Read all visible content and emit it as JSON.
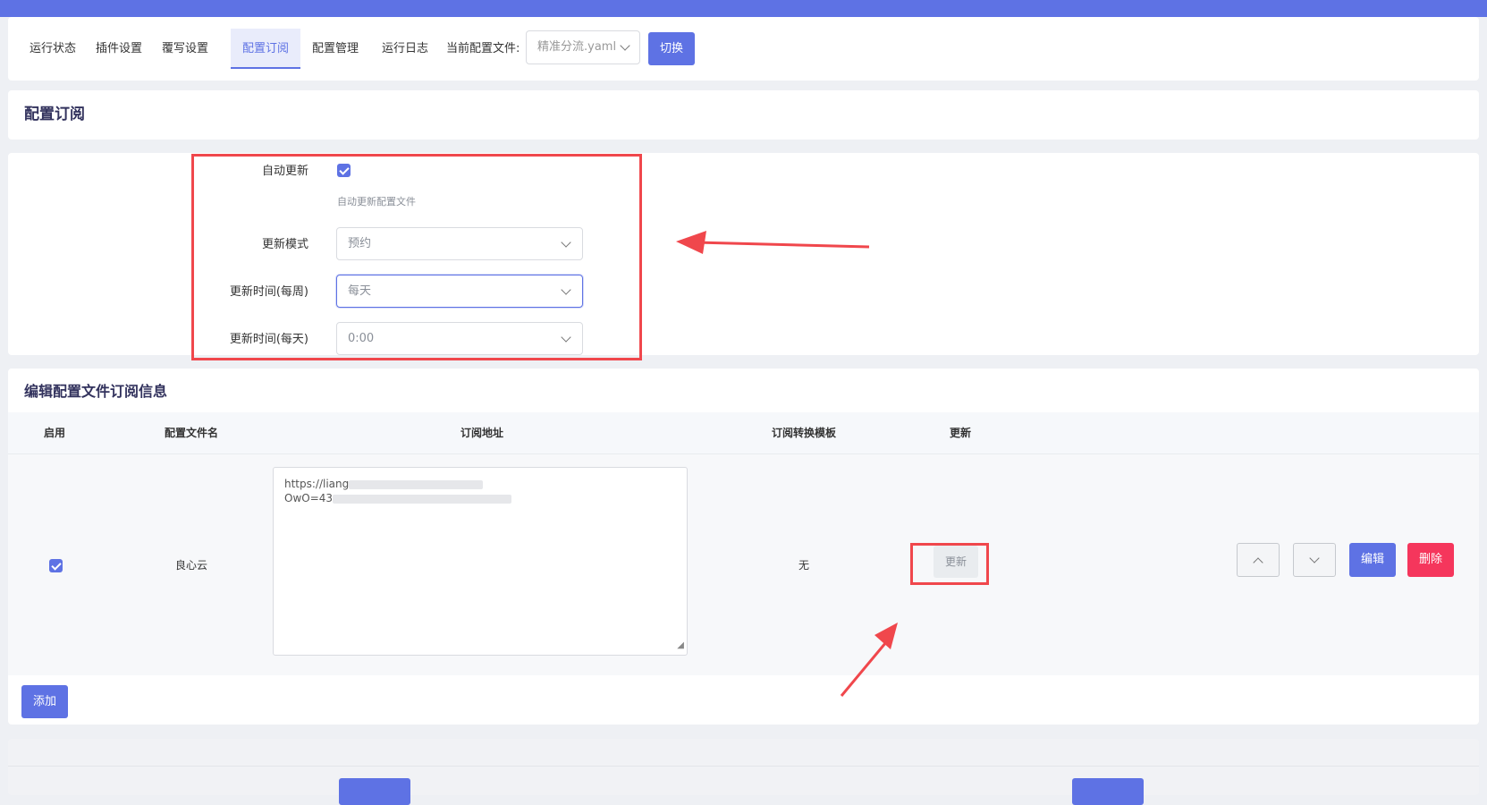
{
  "nav": {
    "tabs": [
      "运行状态",
      "插件设置",
      "覆写设置",
      "配置订阅",
      "配置管理",
      "运行日志"
    ],
    "active_tab": "配置订阅",
    "current_config_label": "当前配置文件:",
    "current_config_value": "精准分流.yaml",
    "switch_label": "切换"
  },
  "page_title": "配置订阅",
  "form": {
    "auto_update_label": "自动更新",
    "auto_update_checked": true,
    "auto_update_hint": "自动更新配置文件",
    "update_mode_label": "更新模式",
    "update_mode_value": "预约",
    "weekly_label": "更新时间(每周)",
    "weekly_value": "每天",
    "daily_label": "更新时间(每天)",
    "daily_value": "0:00"
  },
  "subs": {
    "section_title": "编辑配置文件订阅信息",
    "columns": [
      "启用",
      "配置文件名",
      "订阅地址",
      "订阅转换模板",
      "更新"
    ],
    "rows": [
      {
        "enabled": true,
        "name": "良心云",
        "url_line1": "https://liang",
        "url_line2": "OwO=43",
        "template": "无",
        "update_label": "更新",
        "edit_label": "编辑",
        "delete_label": "删除"
      }
    ],
    "add_label": "添加"
  },
  "footer": {}
}
